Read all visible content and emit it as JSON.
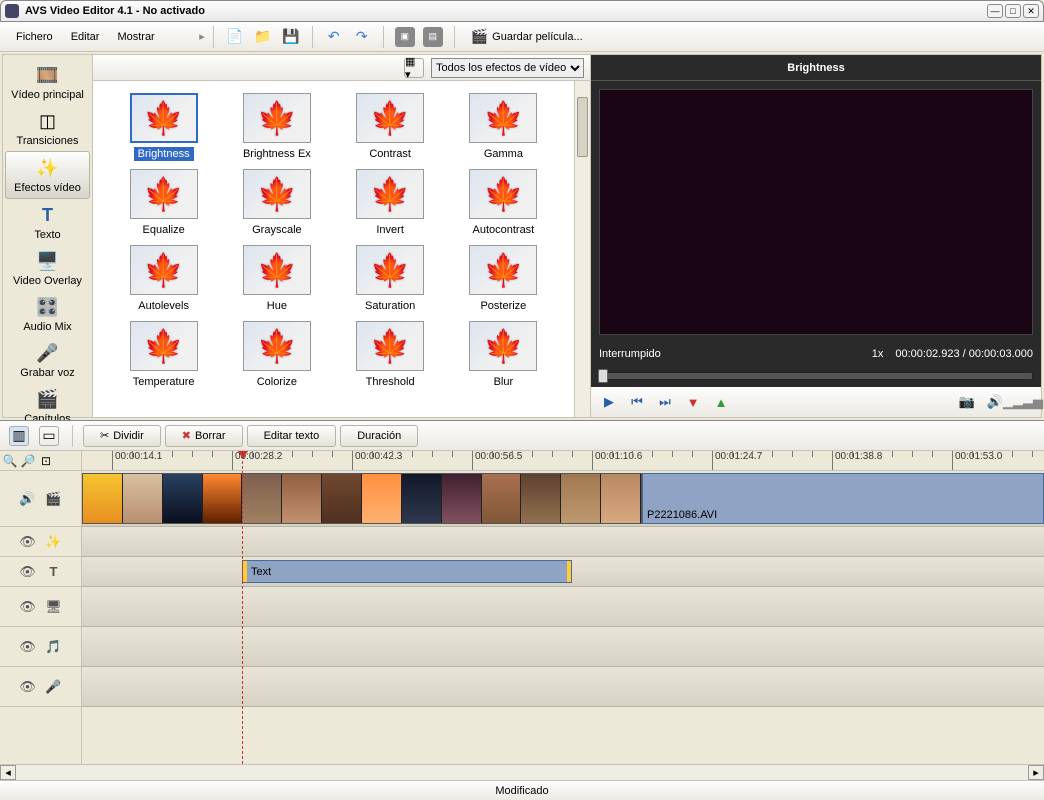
{
  "window": {
    "title": "AVS Video Editor 4.1 - No activado"
  },
  "menu": {
    "file": "Fichero",
    "edit": "Editar",
    "view": "Mostrar",
    "save_movie": "Guardar película..."
  },
  "nav": {
    "main_video": "Vídeo principal",
    "transitions": "Transiciones",
    "video_effects": "Efectos vídeo",
    "text": "Texto",
    "video_overlay": "Video Overlay",
    "audio_mix": "Audio Mix",
    "record_voice": "Grabar voz",
    "chapters": "Capítulos"
  },
  "effects": {
    "filter_label": "Todos los efectos de vídeo",
    "items": [
      {
        "label": "Brightness",
        "color": "#cc5522",
        "sel": true
      },
      {
        "label": "Brightness Ex",
        "color": "#885533"
      },
      {
        "label": "Contrast",
        "color": "#dd2211"
      },
      {
        "label": "Gamma",
        "color": "#885533"
      },
      {
        "label": "Equalize",
        "color": "#cc3311"
      },
      {
        "label": "Grayscale",
        "color": "#888888"
      },
      {
        "label": "Invert",
        "color": "#3388dd"
      },
      {
        "label": "Autocontrast",
        "color": "#cc3322"
      },
      {
        "label": "Autolevels",
        "color": "#cc5522"
      },
      {
        "label": "Hue",
        "color": "#22aa44"
      },
      {
        "label": "Saturation",
        "color": "#cc3311"
      },
      {
        "label": "Posterize",
        "color": "#cc5533"
      },
      {
        "label": "Temperature",
        "color": "#cc3322"
      },
      {
        "label": "Colorize",
        "color": "#cc4444"
      },
      {
        "label": "Threshold",
        "color": "#000000"
      },
      {
        "label": "Blur",
        "color": "#cc5533"
      }
    ]
  },
  "preview": {
    "title": "Brightness",
    "status": "Interrumpido",
    "speed": "1x",
    "time_current": "00:00:02.923",
    "time_total": "00:00:03.000"
  },
  "timeline_bar": {
    "split": "Dividir",
    "delete": "Borrar",
    "edit_text": "Editar texto",
    "duration": "Duración"
  },
  "timeline": {
    "ticks": [
      "00:00:14.1",
      "00:00:28.2",
      "00:00:42.3",
      "00:00:56.5",
      "00:01:10.6",
      "00:01:24.7",
      "00:01:38.8",
      "00:01:53.0"
    ],
    "clip_name": "P2221086.AVI",
    "text_clip": "Text"
  },
  "statusbar": {
    "modified": "Modificado"
  }
}
